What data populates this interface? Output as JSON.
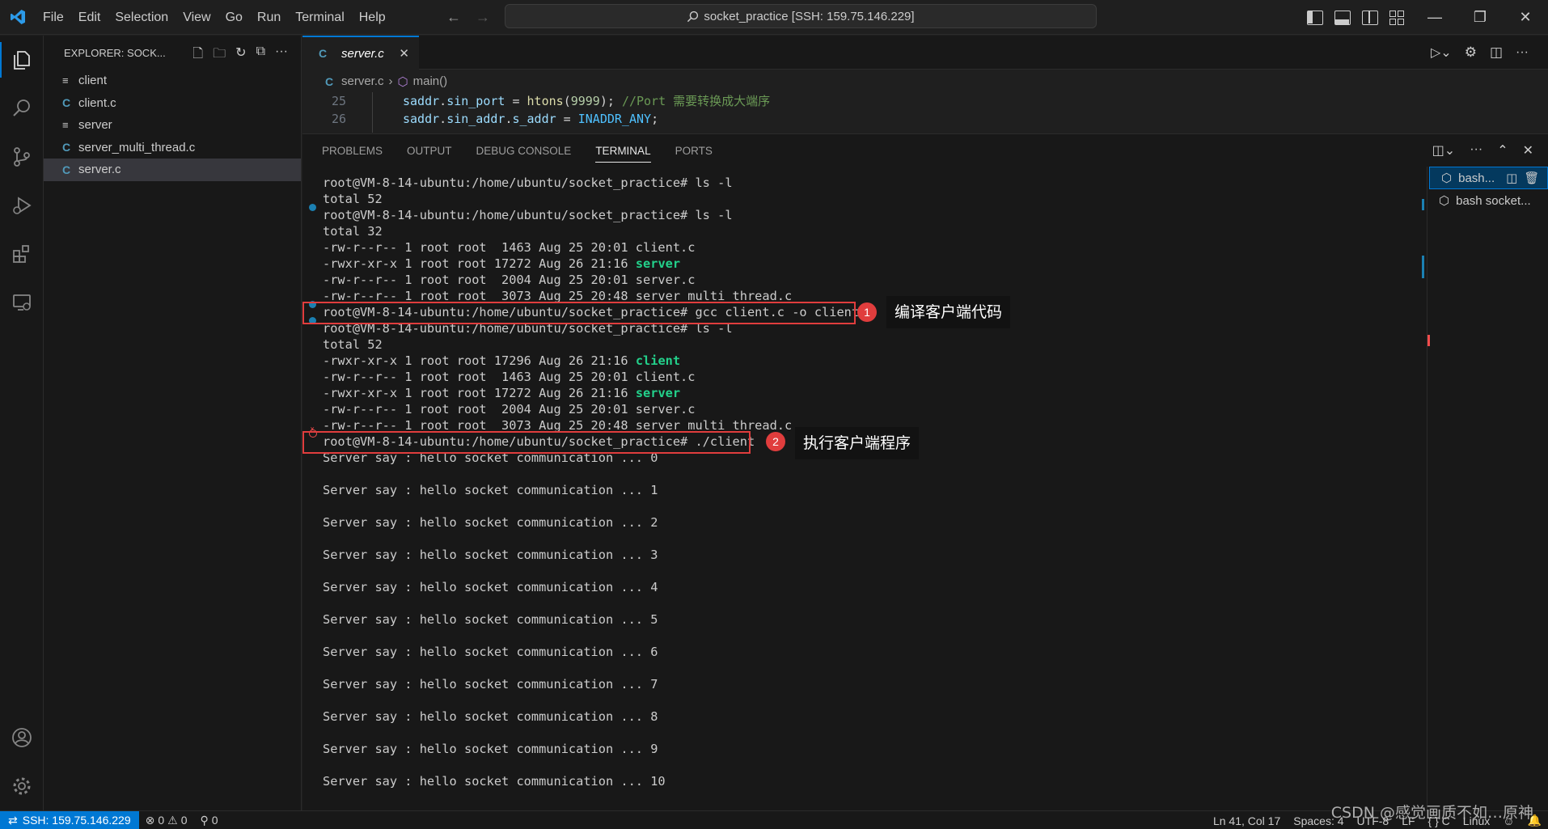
{
  "titlebar": {
    "menu": [
      "File",
      "Edit",
      "Selection",
      "View",
      "Go",
      "Run",
      "Terminal",
      "Help"
    ],
    "search_text": "socket_practice [SSH: 159.75.146.229]"
  },
  "sidebar": {
    "header": "EXPLORER: SOCK...",
    "files": [
      {
        "name": "client",
        "icon": "≡"
      },
      {
        "name": "client.c",
        "icon": "C"
      },
      {
        "name": "server",
        "icon": "≡"
      },
      {
        "name": "server_multi_thread.c",
        "icon": "C"
      },
      {
        "name": "server.c",
        "icon": "C"
      }
    ]
  },
  "editor": {
    "tab_icon": "C",
    "tab_label": "server.c",
    "breadcrumb_file": "server.c",
    "breadcrumb_symbol": "main()",
    "lines": [
      {
        "num": "25",
        "text": "saddr.sin_port = htons(9999); //Port 需要转换成大端序"
      },
      {
        "num": "26",
        "text": "saddr.sin_addr.s_addr = INADDR_ANY;"
      }
    ]
  },
  "panel": {
    "tabs": [
      "PROBLEMS",
      "OUTPUT",
      "DEBUG CONSOLE",
      "TERMINAL",
      "PORTS"
    ],
    "active_tab": "TERMINAL",
    "terminal_lines": [
      "root@VM-8-14-ubuntu:/home/ubuntu/socket_practice# ls -l",
      "total 52",
      "root@VM-8-14-ubuntu:/home/ubuntu/socket_practice# ls -l",
      "total 32",
      "-rw-r--r-- 1 root root  1463 Aug 25 20:01 client.c",
      "-rwxr-xr-x 1 root root 17272 Aug 26 21:16 ",
      "server",
      "-rw-r--r-- 1 root root  2004 Aug 25 20:01 server.c",
      "-rw-r--r-- 1 root root  3073 Aug 25 20:48 server_multi_thread.c",
      "root@VM-8-14-ubuntu:/home/ubuntu/socket_practice# gcc client.c -o client",
      "root@VM-8-14-ubuntu:/home/ubuntu/socket_practice# ls -l",
      "total 52",
      "-rwxr-xr-x 1 root root 17296 Aug 26 21:16 ",
      "client",
      "-rw-r--r-- 1 root root  1463 Aug 25 20:01 client.c",
      "-rwxr-xr-x 1 root root 17272 Aug 26 21:16 ",
      "server",
      "-rw-r--r-- 1 root root  2004 Aug 25 20:01 server.c",
      "-rw-r--r-- 1 root root  3073 Aug 25 20:48 server_multi_thread.c",
      "root@VM-8-14-ubuntu:/home/ubuntu/socket_practice# ./client"
    ],
    "output_lines": [
      "Server say : hello socket communication ... 0",
      "Server say : hello socket communication ... 1",
      "Server say : hello socket communication ... 2",
      "Server say : hello socket communication ... 3",
      "Server say : hello socket communication ... 4",
      "Server say : hello socket communication ... 5",
      "Server say : hello socket communication ... 6",
      "Server say : hello socket communication ... 7",
      "Server say : hello socket communication ... 8",
      "Server say : hello socket communication ... 9",
      "Server say : hello socket communication ... 10"
    ],
    "terminals": [
      "bash...",
      "bash socket..."
    ]
  },
  "annotations": [
    {
      "badge": "1",
      "text": "编译客户端代码"
    },
    {
      "badge": "2",
      "text": "执行客户端程序"
    }
  ],
  "statusbar": {
    "remote": "SSH: 159.75.146.229",
    "errors": "0",
    "warnings": "0",
    "ports": "0",
    "position": "Ln 41, Col 17",
    "spaces": "Spaces: 4",
    "encoding": "UTF-8",
    "eol": "LF",
    "language": "{ } C",
    "platform": "Linux"
  },
  "watermark": "CSDN @感觉画质不如…原神",
  "colors": {
    "accent": "#0078d4",
    "highlight": "#e03d3d",
    "green_exec": "#23d18b"
  }
}
